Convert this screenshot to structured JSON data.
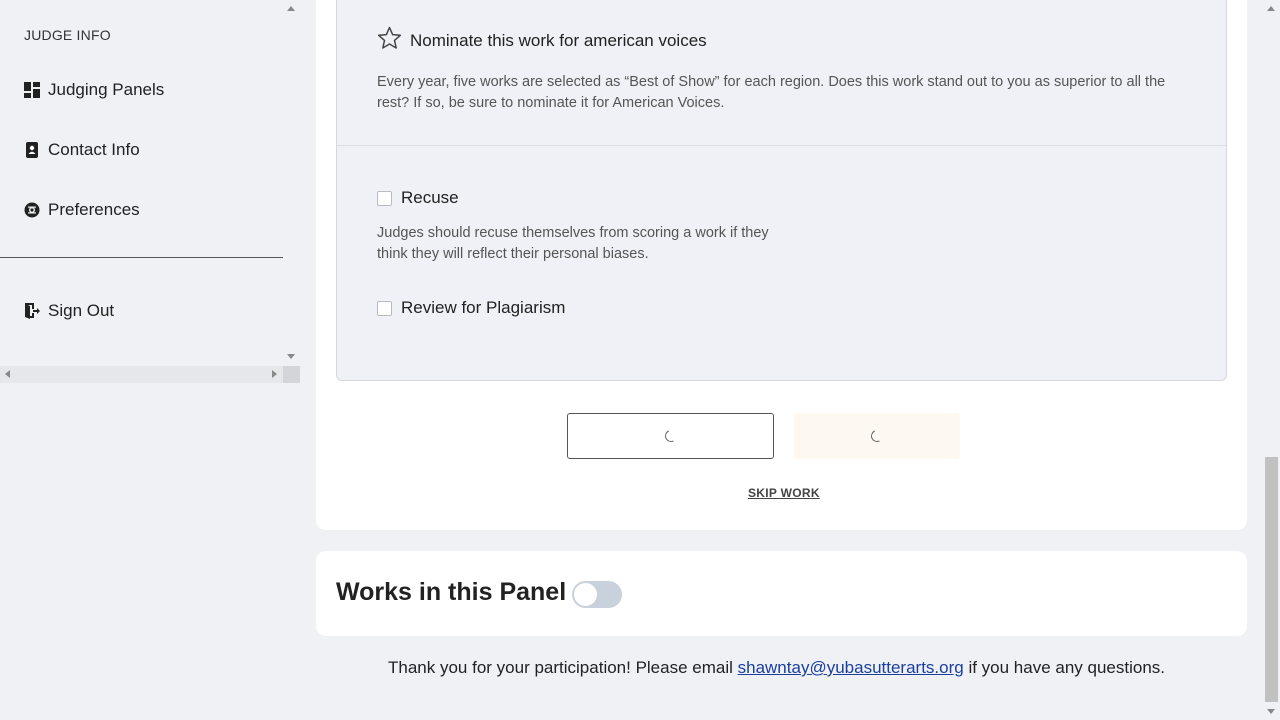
{
  "sidebar": {
    "heading": "JUDGE INFO",
    "items": [
      {
        "label": "Judging Panels",
        "icon": "dashboard-icon"
      },
      {
        "label": "Contact Info",
        "icon": "contact-book-icon"
      },
      {
        "label": "Preferences",
        "icon": "gear-icon"
      }
    ],
    "sign_out": {
      "label": "Sign Out",
      "icon": "sign-out-icon"
    }
  },
  "options": {
    "nominate": {
      "label": "Nominate this work for american voices",
      "description": "Every year, five works are selected as “Best of Show” for each region. Does this work stand out to you as superior to all the rest? If so, be sure to nominate it for American Voices.",
      "icon": "star-outline-icon"
    },
    "recuse": {
      "label": "Recuse",
      "description": "Judges should recuse themselves from scoring a work if they think they will reflect their personal biases.",
      "checked": false
    },
    "plagiarism": {
      "label": "Review for Plagiarism",
      "checked": false
    }
  },
  "actions": {
    "skip_label": "SKIP WORK"
  },
  "works_panel": {
    "title": "Works in this Panel",
    "toggle_on": false
  },
  "footer": {
    "prefix": "Thank you for your participation! Please email ",
    "email": "shawntay@yubasutterarts.org",
    "suffix": " if you have any questions."
  },
  "colors": {
    "background": "#f0f1f5",
    "card": "#ffffff",
    "link": "#1a3f9e",
    "toggle_off": "#c8d1dc"
  }
}
